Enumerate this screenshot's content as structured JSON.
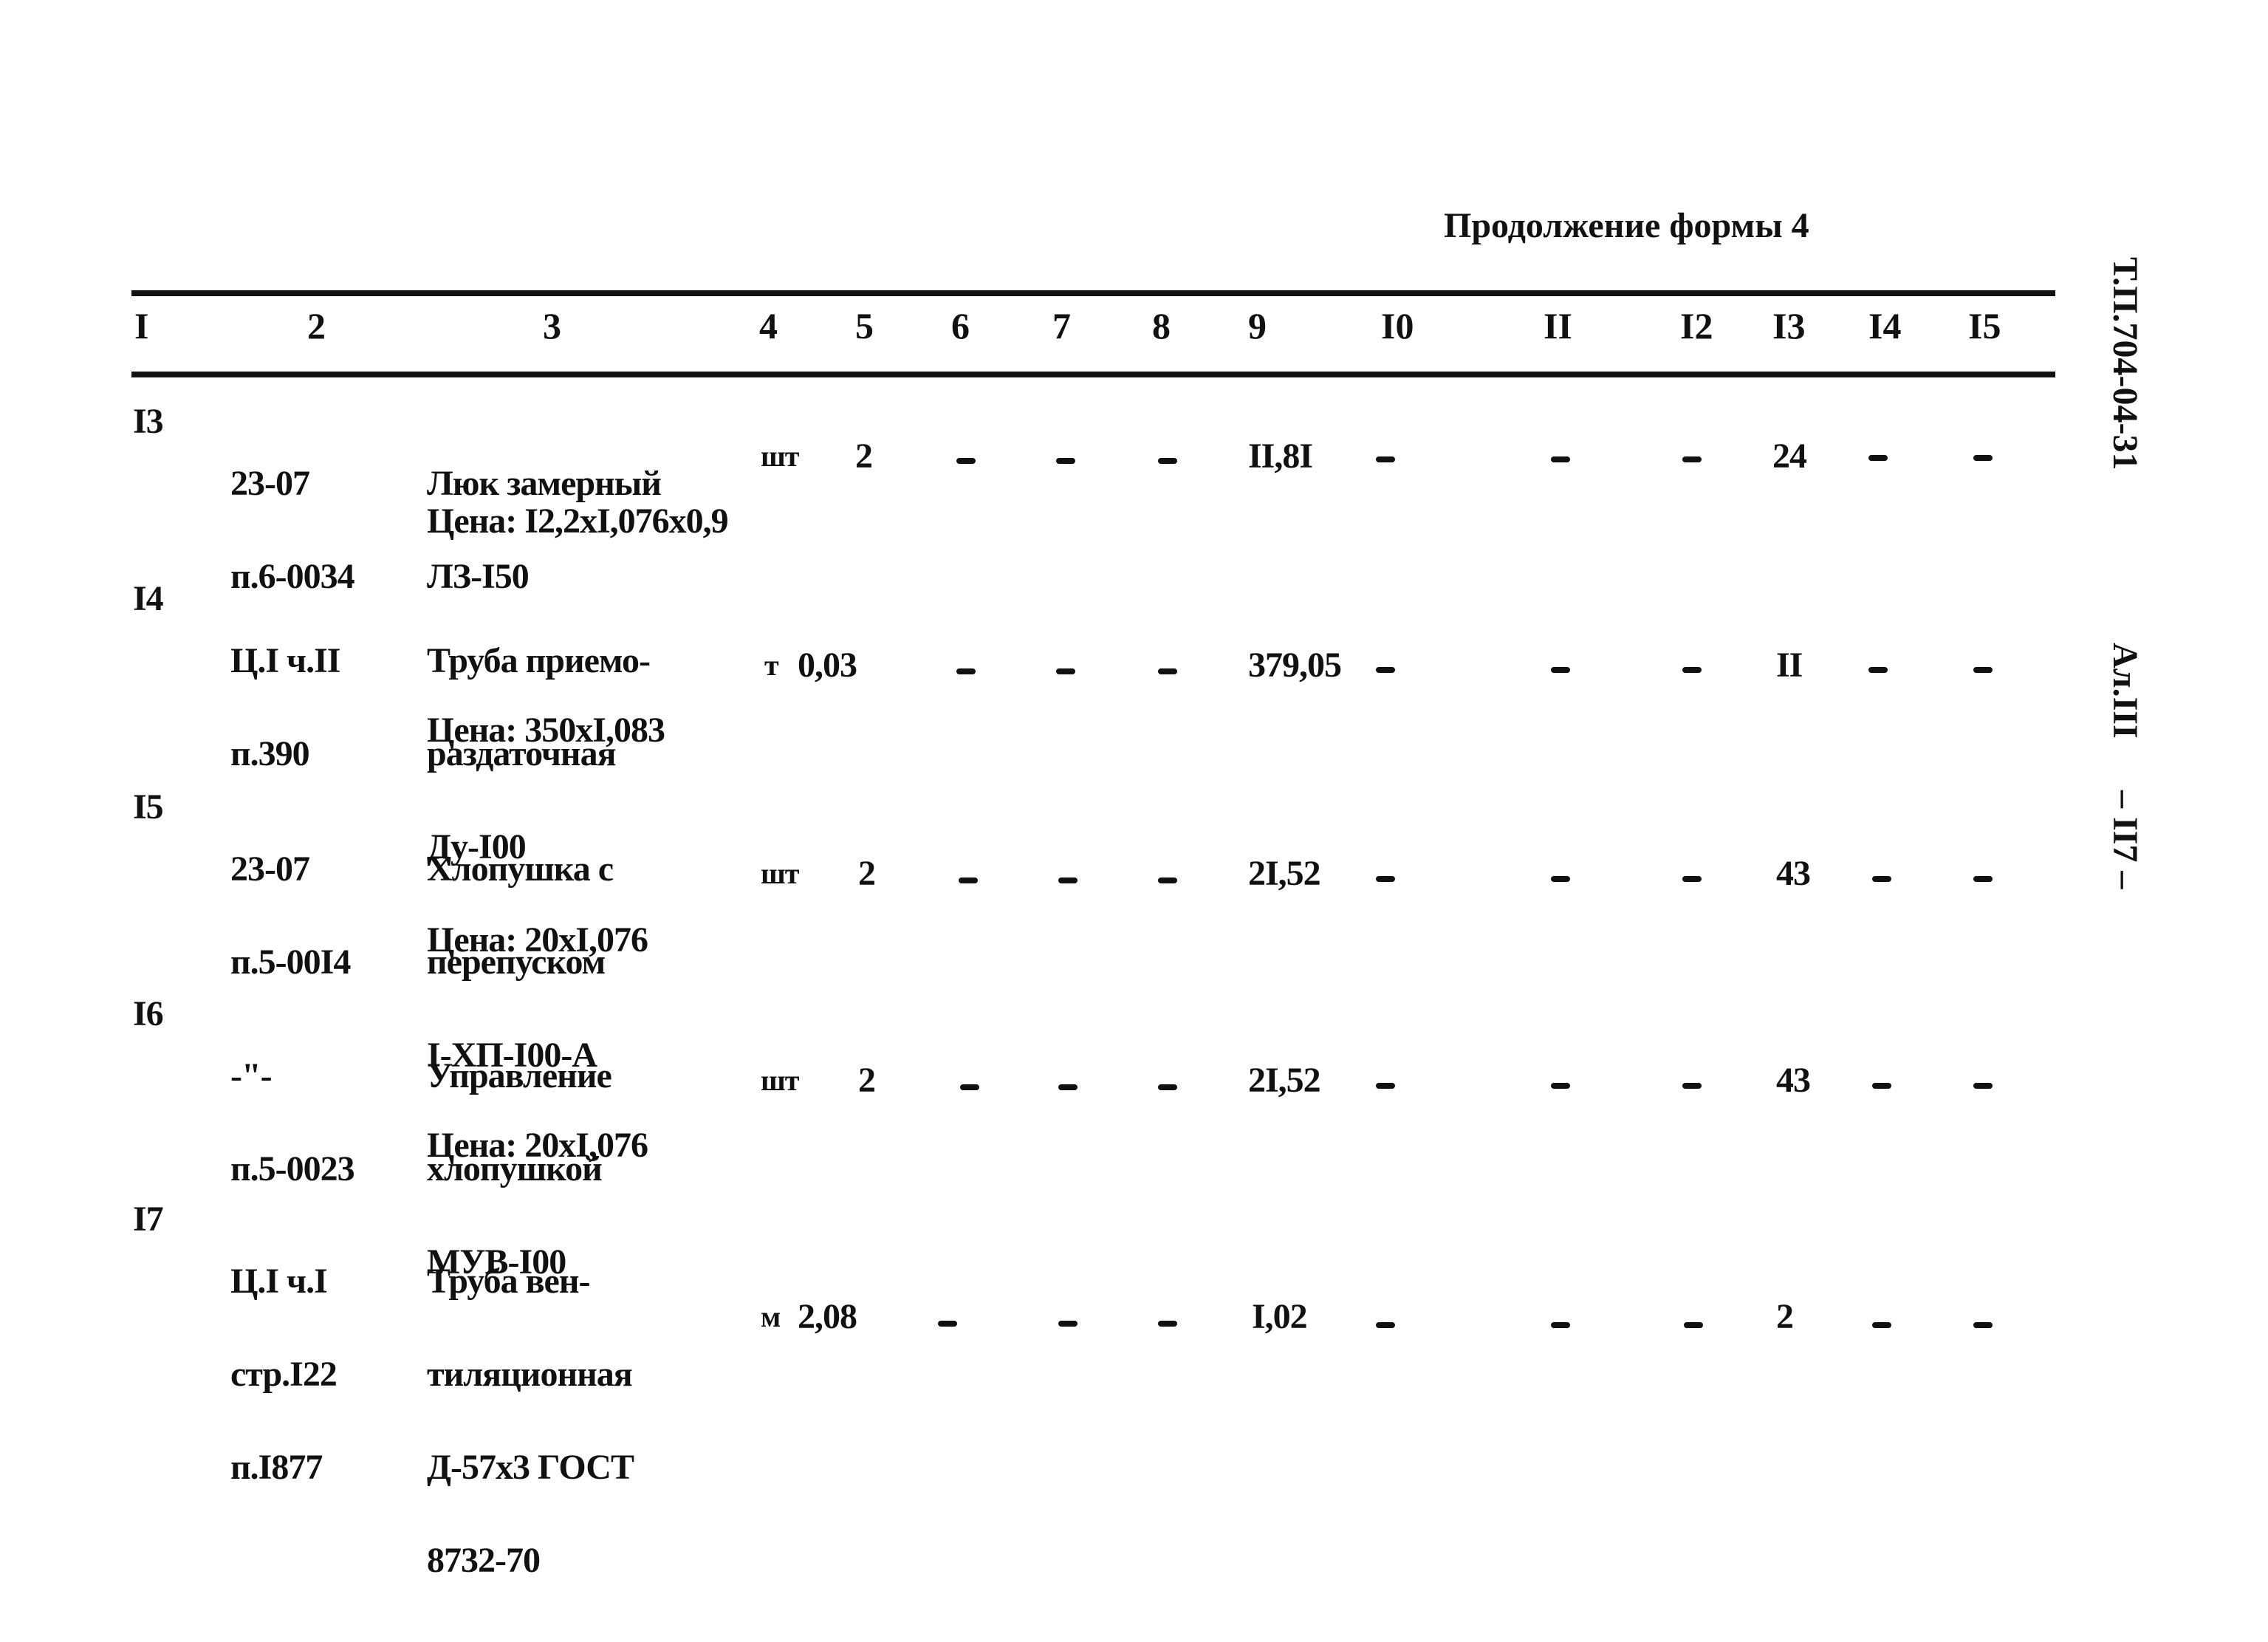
{
  "header": {
    "title": "Продолжение формы 4"
  },
  "side_labels": {
    "doc_code": "Т.П.704-04-31",
    "album": "Ал.III",
    "page": "– II7 –"
  },
  "columns": [
    "I",
    "2",
    "3",
    "4",
    "5",
    "6",
    "7",
    "8",
    "9",
    "I0",
    "II",
    "I2",
    "I3",
    "I4",
    "I5"
  ],
  "rows": [
    {
      "num": "I3",
      "ref": [
        "23-07",
        "п.6-0034"
      ],
      "name": [
        "Люк замерный",
        "ЛЗ-I50"
      ],
      "price": "Цена: I2,2xI,076x0,9",
      "unit": "шт",
      "qty": "2",
      "c6": "–",
      "c7": "–",
      "c8": "–",
      "c9": "II,8I",
      "c10": "–",
      "c11": "–",
      "c12": "–",
      "c13": "24",
      "c14": "–",
      "c15": "–"
    },
    {
      "num": "I4",
      "ref": [
        "Ц.I ч.II",
        "п.390"
      ],
      "name": [
        "Труба приемо-",
        "раздаточная",
        "Ду-I00"
      ],
      "price": "Цена: 350xI,083",
      "unit": "т",
      "qty": "0,03",
      "c6": "–",
      "c7": "–",
      "c8": "–",
      "c9": "379,05",
      "c10": "–",
      "c11": "–",
      "c12": "–",
      "c13": "II",
      "c14": "–",
      "c15": "–"
    },
    {
      "num": "I5",
      "ref": [
        "23-07",
        "п.5-00I4"
      ],
      "name": [
        "Хлопушка с",
        "перепуском",
        "I-ХП-I00-А"
      ],
      "price": "Цена: 20xI,076",
      "unit": "шт",
      "qty": "2",
      "c6": "–",
      "c7": "–",
      "c8": "–",
      "c9": "2I,52",
      "c10": "–",
      "c11": "–",
      "c12": "–",
      "c13": "43",
      "c14": "–",
      "c15": "–"
    },
    {
      "num": "I6",
      "ref": [
        "-\"-",
        "п.5-0023"
      ],
      "name": [
        "Управление",
        "хлопушкой",
        "МУВ-I00"
      ],
      "price": "Цена: 20xI,076",
      "unit": "шт",
      "qty": "2",
      "c6": "–",
      "c7": "–",
      "c8": "–",
      "c9": "2I,52",
      "c10": "–",
      "c11": "–",
      "c12": "–",
      "c13": "43",
      "c14": "–",
      "c15": "–"
    },
    {
      "num": "I7",
      "ref": [
        "Ц.I ч.I",
        "стр.I22",
        "п.I877"
      ],
      "name": [
        "Труба вен-",
        "тиляционная",
        "Д-57х3 ГОСТ",
        "8732-70"
      ],
      "price": "",
      "unit": "м",
      "qty": "2,08",
      "c6": "–",
      "c7": "–",
      "c8": "–",
      "c9": "I,02",
      "c10": "–",
      "c11": "–",
      "c12": "–",
      "c13": "2",
      "c14": "–",
      "c15": "–"
    }
  ]
}
